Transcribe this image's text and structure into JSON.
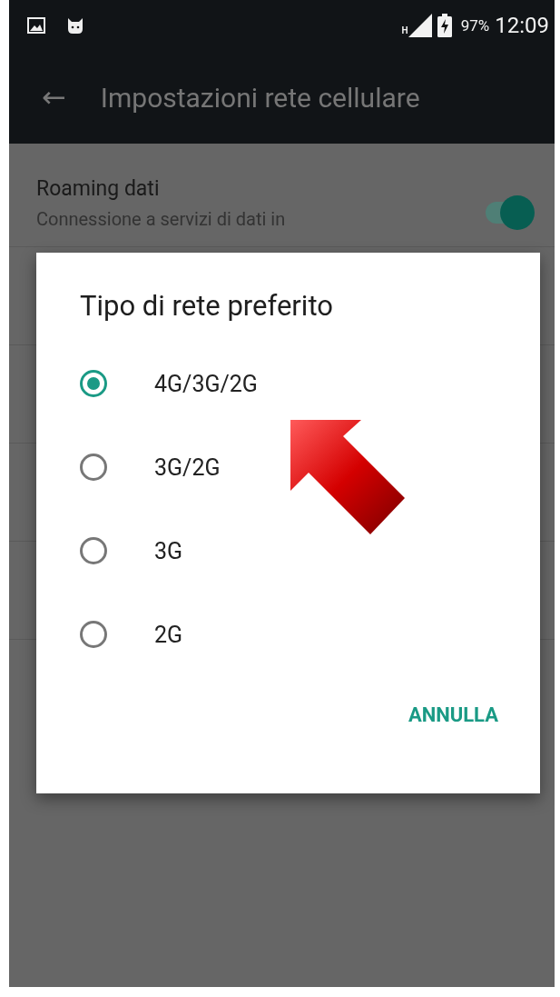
{
  "status_bar": {
    "network_type": "H",
    "battery": "97%",
    "time": "12:09"
  },
  "app_bar": {
    "back": "←",
    "title": "Impostazioni rete cellulare"
  },
  "settings": [
    {
      "title": "Roaming dati",
      "summary": "Connessione a servizi di dati in",
      "on": true
    }
  ],
  "dialog": {
    "title": "Tipo di rete preferito",
    "options": [
      {
        "label": "4G/3G/2G",
        "selected": true
      },
      {
        "label": "3G/2G",
        "selected": false
      },
      {
        "label": "3G",
        "selected": false
      },
      {
        "label": "2G",
        "selected": false
      }
    ],
    "buttons": [
      "ANNULLA"
    ]
  }
}
